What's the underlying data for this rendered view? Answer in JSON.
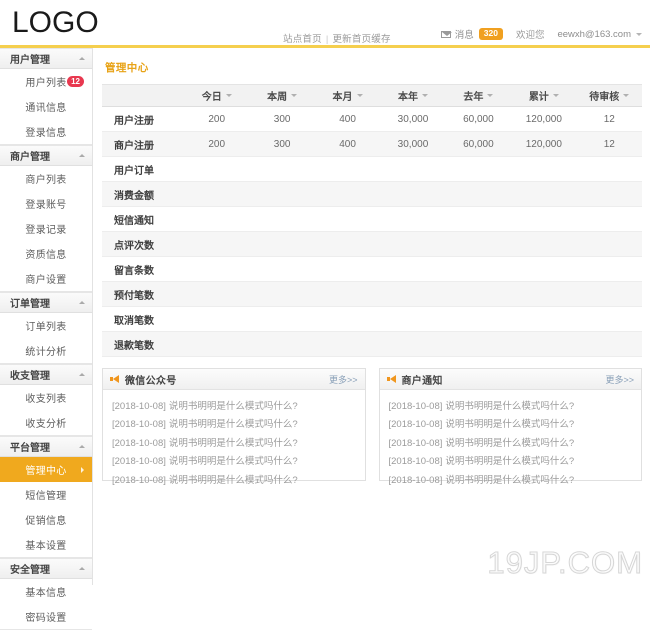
{
  "header": {
    "logo": "LOGO",
    "center_links": [
      "站点首页",
      "更新首页缓存"
    ],
    "separator": "|",
    "message_label": "消息",
    "message_count": "320",
    "welcome": "欢迎您",
    "email": "eewxh@163.com"
  },
  "colors": {
    "accent_gold": "#f0a91e",
    "top_bar": "#f5cf4e",
    "badge_red": "#e8384f",
    "badge_orange": "#f0a020",
    "title_gold": "#e8a317",
    "more_link": "#8aa0b8"
  },
  "sidebar": {
    "groups": [
      {
        "title": "用户管理",
        "items": [
          {
            "label": "用户列表",
            "badge": "12",
            "active": false
          },
          {
            "label": "通讯信息",
            "badge": "",
            "active": false
          },
          {
            "label": "登录信息",
            "badge": "",
            "active": false
          }
        ]
      },
      {
        "title": "商户管理",
        "items": [
          {
            "label": "商户列表",
            "badge": "",
            "active": false
          },
          {
            "label": "登录账号",
            "badge": "",
            "active": false
          },
          {
            "label": "登录记录",
            "badge": "",
            "active": false
          },
          {
            "label": "资质信息",
            "badge": "",
            "active": false
          },
          {
            "label": "商户设置",
            "badge": "",
            "active": false
          }
        ]
      },
      {
        "title": "订单管理",
        "items": [
          {
            "label": "订单列表",
            "badge": "",
            "active": false
          },
          {
            "label": "统计分析",
            "badge": "",
            "active": false
          }
        ]
      },
      {
        "title": "收支管理",
        "items": [
          {
            "label": "收支列表",
            "badge": "",
            "active": false
          },
          {
            "label": "收支分析",
            "badge": "",
            "active": false
          }
        ]
      },
      {
        "title": "平台管理",
        "items": [
          {
            "label": "管理中心",
            "badge": "",
            "active": true
          },
          {
            "label": "短信管理",
            "badge": "",
            "active": false
          },
          {
            "label": "促销信息",
            "badge": "",
            "active": false
          },
          {
            "label": "基本设置",
            "badge": "",
            "active": false
          }
        ]
      },
      {
        "title": "安全管理",
        "items": [
          {
            "label": "基本信息",
            "badge": "",
            "active": false
          },
          {
            "label": "密码设置",
            "badge": "",
            "active": false
          }
        ]
      }
    ]
  },
  "main": {
    "page_title": "管理中心",
    "table": {
      "columns": [
        "",
        "今日",
        "本周",
        "本月",
        "本年",
        "去年",
        "累计",
        "待审核"
      ],
      "rows": [
        {
          "label": "用户注册",
          "values": [
            "200",
            "300",
            "400",
            "30,000",
            "60,000",
            "120,000",
            "12"
          ]
        },
        {
          "label": "商户注册",
          "values": [
            "200",
            "300",
            "400",
            "30,000",
            "60,000",
            "120,000",
            "12"
          ]
        },
        {
          "label": "用户订单",
          "values": [
            "",
            "",
            "",
            "",
            "",
            "",
            ""
          ]
        },
        {
          "label": "消费金额",
          "values": [
            "",
            "",
            "",
            "",
            "",
            "",
            ""
          ]
        },
        {
          "label": "短信通知",
          "values": [
            "",
            "",
            "",
            "",
            "",
            "",
            ""
          ]
        },
        {
          "label": "点评次数",
          "values": [
            "",
            "",
            "",
            "",
            "",
            "",
            ""
          ]
        },
        {
          "label": "留言条数",
          "values": [
            "",
            "",
            "",
            "",
            "",
            "",
            ""
          ]
        },
        {
          "label": "预付笔数",
          "values": [
            "",
            "",
            "",
            "",
            "",
            "",
            ""
          ]
        },
        {
          "label": "取消笔数",
          "values": [
            "",
            "",
            "",
            "",
            "",
            "",
            ""
          ]
        },
        {
          "label": "退款笔数",
          "values": [
            "",
            "",
            "",
            "",
            "",
            "",
            ""
          ]
        }
      ]
    },
    "panels": [
      {
        "title": "微信公众号",
        "more": "更多>>",
        "notices": [
          {
            "date": "[2018-10-08]",
            "text": "说明书明明是什么模式吗什么?"
          },
          {
            "date": "[2018-10-08]",
            "text": "说明书明明是什么模式吗什么?"
          },
          {
            "date": "[2018-10-08]",
            "text": "说明书明明是什么模式吗什么?"
          },
          {
            "date": "[2018-10-08]",
            "text": "说明书明明是什么模式吗什么?"
          },
          {
            "date": "[2018-10-08]",
            "text": "说明书明明是什么模式吗什么?"
          }
        ]
      },
      {
        "title": "商户通知",
        "more": "更多>>",
        "notices": [
          {
            "date": "[2018-10-08]",
            "text": "说明书明明是什么模式吗什么?"
          },
          {
            "date": "[2018-10-08]",
            "text": "说明书明明是什么模式吗什么?"
          },
          {
            "date": "[2018-10-08]",
            "text": "说明书明明是什么模式吗什么?"
          },
          {
            "date": "[2018-10-08]",
            "text": "说明书明明是什么模式吗什么?"
          },
          {
            "date": "[2018-10-08]",
            "text": "说明书明明是什么模式吗什么?"
          }
        ]
      }
    ]
  },
  "watermark": "19JP.COM"
}
